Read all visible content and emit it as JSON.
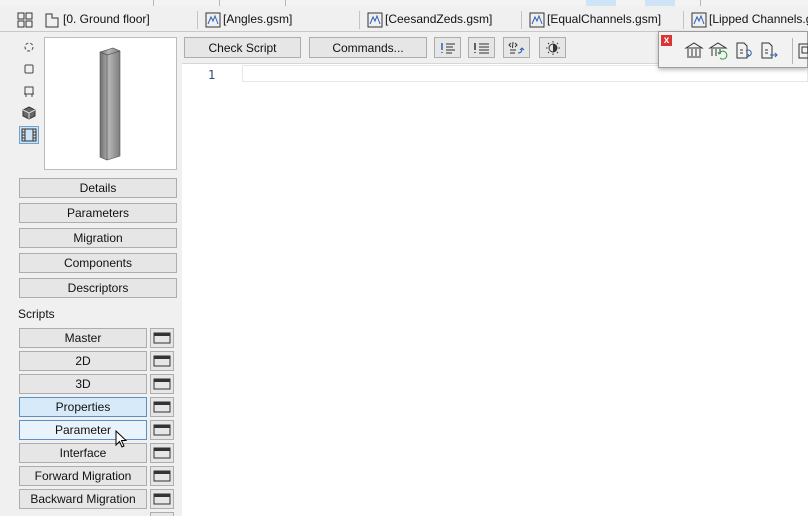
{
  "tabs": [
    {
      "label": "[0. Ground floor]",
      "icon": "floor-plan-icon"
    },
    {
      "label": "[Angles.gsm]",
      "icon": "gdl-object-icon"
    },
    {
      "label": "[CeesandZeds.gsm]",
      "icon": "gdl-object-icon"
    },
    {
      "label": "[EqualChannels.gsm]",
      "icon": "gdl-object-icon"
    },
    {
      "label": "[Lipped Channels.g",
      "icon": "gdl-object-icon"
    }
  ],
  "left_panel": {
    "view_icons": [
      "rotate-view-icon",
      "plan-view-icon",
      "elevation-view-icon",
      "3d-view-icon",
      "film-strip-icon"
    ],
    "section_buttons": [
      "Details",
      "Parameters",
      "Migration",
      "Components",
      "Descriptors"
    ],
    "scripts_label": "Scripts",
    "script_buttons": [
      "Master",
      "2D",
      "3D",
      "Properties",
      "Parameter",
      "Interface",
      "Forward Migration",
      "Backward Migration"
    ],
    "selected_script": "Properties",
    "hovered_script": "Parameter"
  },
  "toolbar": {
    "check_script_label": "Check Script",
    "commands_label": "Commands...",
    "icons": [
      "indent-icon",
      "list-icon",
      "code-format-icon",
      "brightness-icon"
    ]
  },
  "editor": {
    "line_numbers": [
      "1"
    ]
  },
  "palette": {
    "close_glyph": "x",
    "icons": [
      "library-icon",
      "reload-library-icon",
      "object-sync-icon",
      "object-export-icon",
      "window-icon"
    ]
  },
  "colors": {
    "accent": "#5c8fc2",
    "selected_bg": "#d7eaf9",
    "close_red": "#dd3333"
  }
}
